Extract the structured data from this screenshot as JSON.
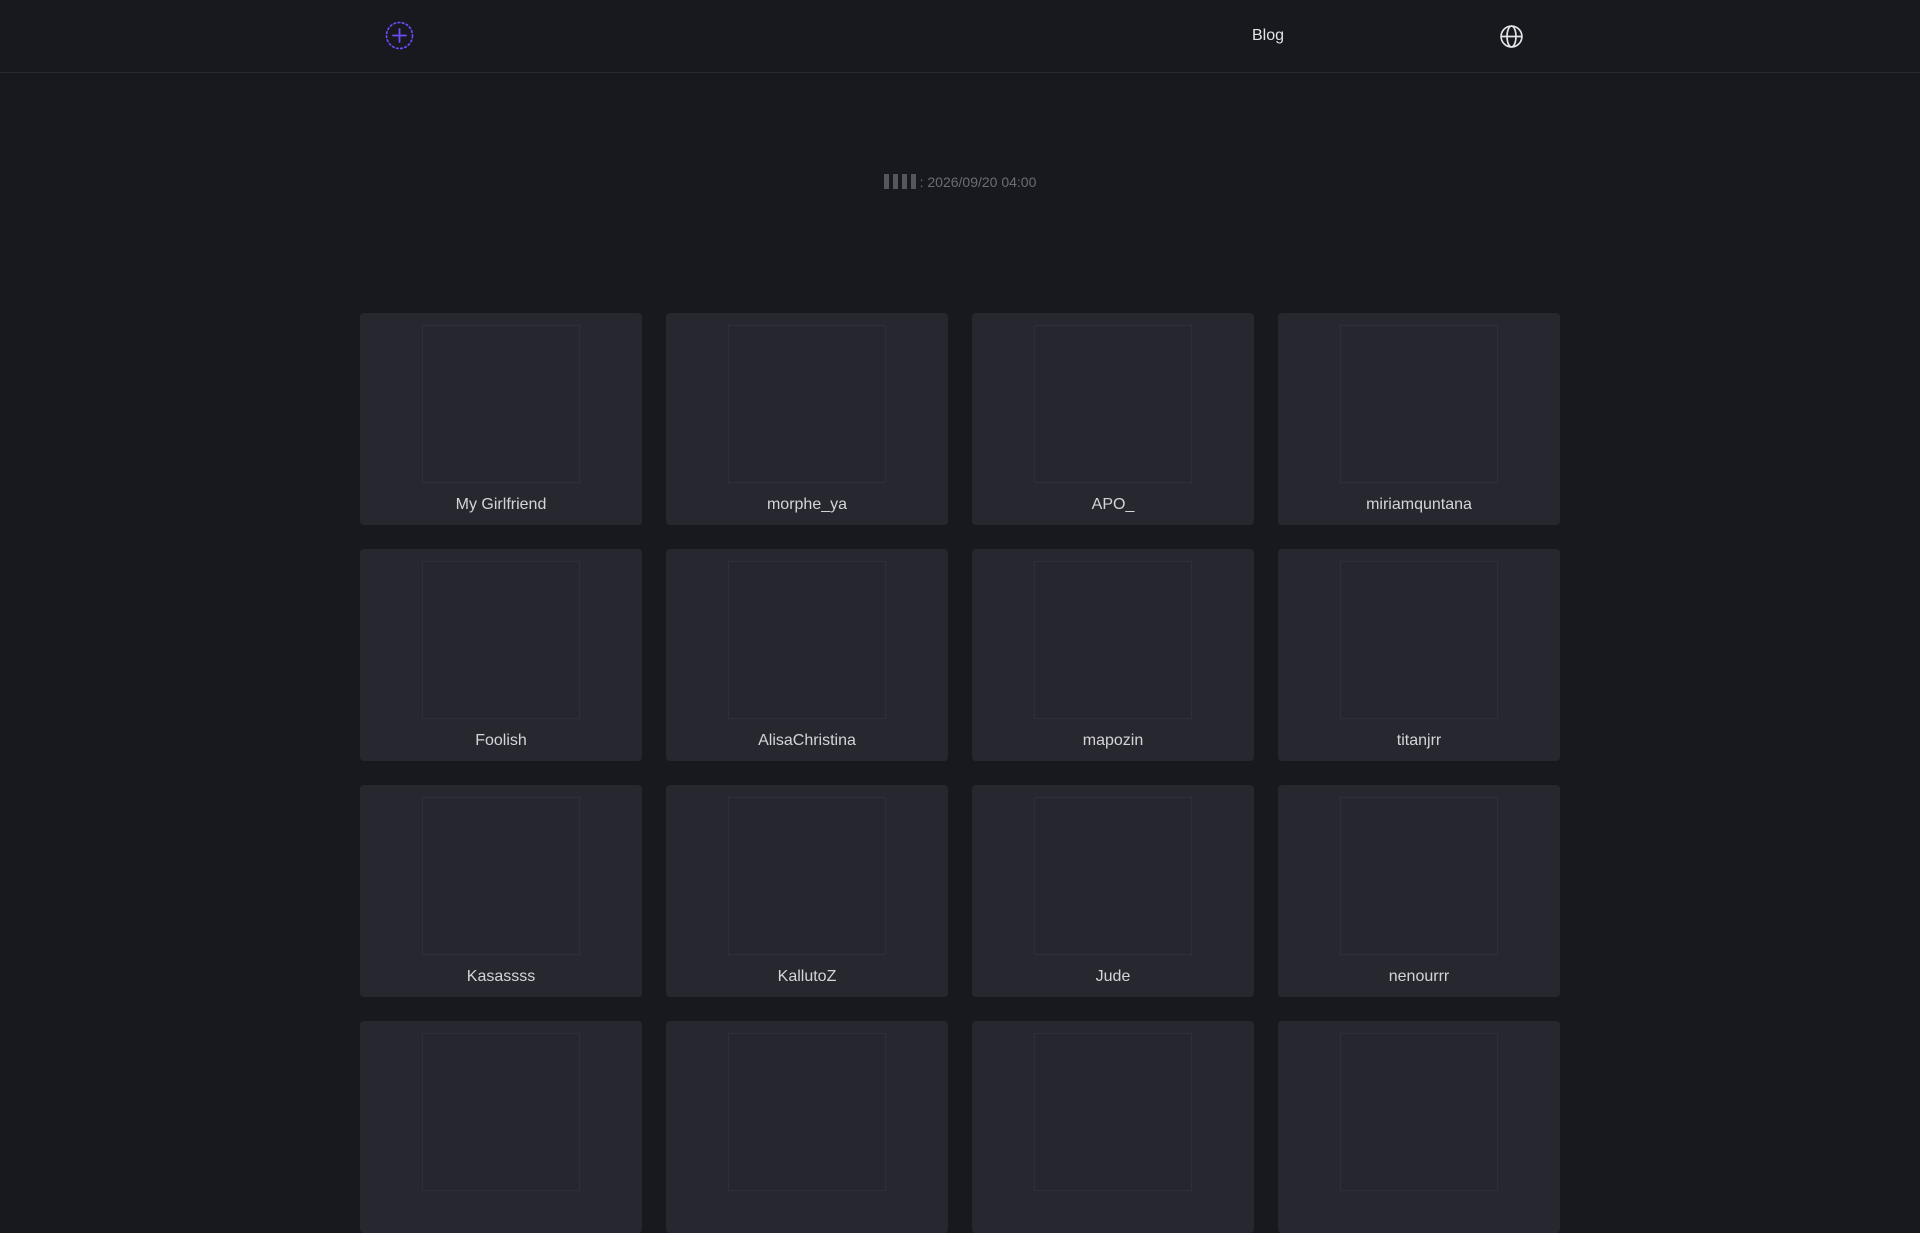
{
  "header": {
    "blog_label": "Blog",
    "logo_icon": "plus-circle-icon",
    "language_icon": "globe-icon",
    "accent_color": "#6d4aff"
  },
  "updated": {
    "prefix_glyph_count": 4,
    "value": ": 2026/09/20 04:00"
  },
  "cards": [
    {
      "name": "My Girlfriend"
    },
    {
      "name": "morphe_ya"
    },
    {
      "name": "APO_"
    },
    {
      "name": "miriamquntana"
    },
    {
      "name": "Foolish"
    },
    {
      "name": "AlisaChristina"
    },
    {
      "name": "mapozin"
    },
    {
      "name": "titanjrr"
    },
    {
      "name": "Kasassss"
    },
    {
      "name": "KallutoZ"
    },
    {
      "name": "Jude"
    },
    {
      "name": "nenourrr"
    },
    {
      "name": ""
    },
    {
      "name": ""
    },
    {
      "name": ""
    },
    {
      "name": ""
    }
  ]
}
